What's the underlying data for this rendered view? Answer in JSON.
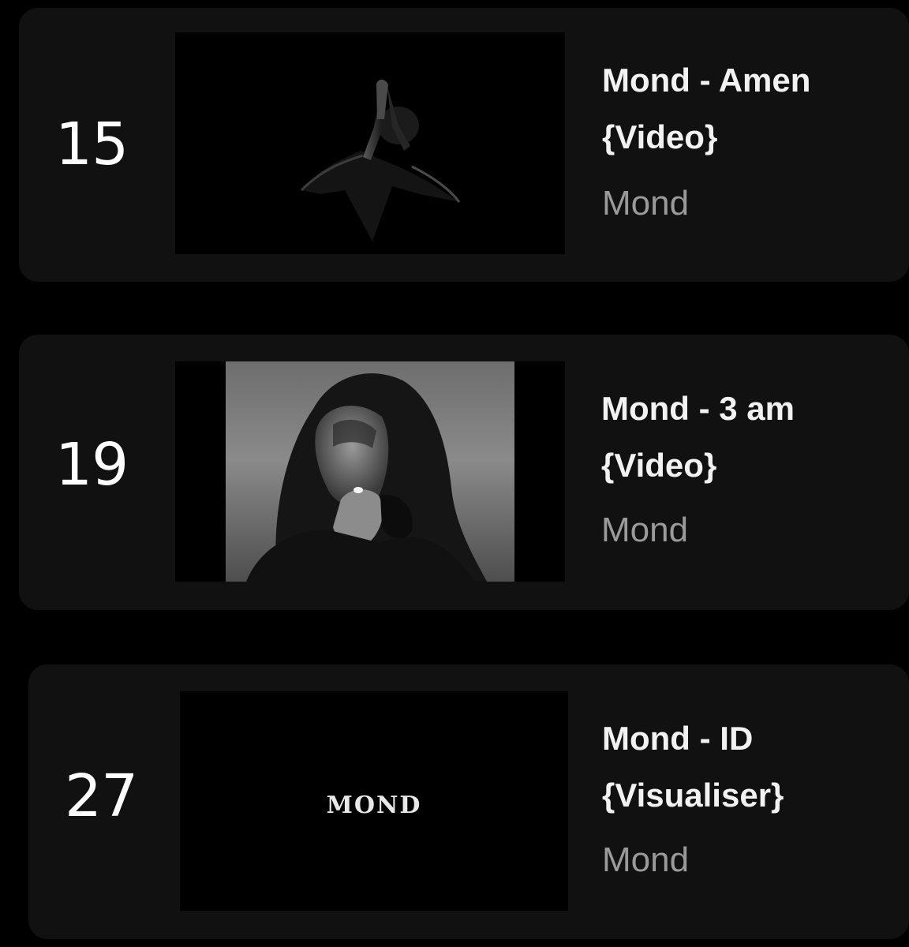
{
  "entries": [
    {
      "rank": "15",
      "title_line1": "Mond - Amen",
      "title_line2": "{Video}",
      "artist": "Mond",
      "thumbnail": "praying-hands-silhouette-thumbnail"
    },
    {
      "rank": "19",
      "title_line1": "Mond - 3 am",
      "title_line2": "{Video}",
      "artist": "Mond",
      "thumbnail": "hooded-person-smoking-thumbnail"
    },
    {
      "rank": "27",
      "title_line1": "Mond - ID",
      "title_line2": "{Visualiser}",
      "artist": "Mond",
      "thumbnail": "gothic-logo-thumbnail",
      "logo_text": "MOND"
    }
  ],
  "colors": {
    "background": "#000000",
    "card": "#111112",
    "title": "#f2f2f2",
    "artist": "#9a9a9a"
  }
}
